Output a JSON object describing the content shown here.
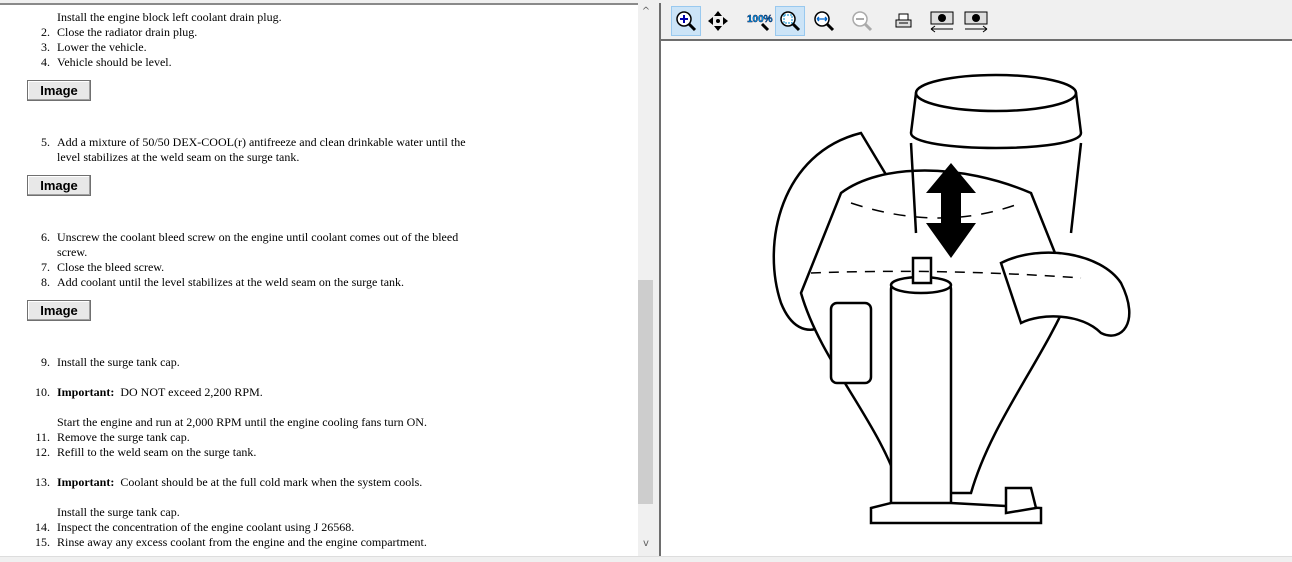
{
  "steps": [
    {
      "num": "",
      "text": "Install the engine block left coolant drain plug."
    },
    {
      "num": "2.",
      "text": "Close the radiator drain plug."
    },
    {
      "num": "3.",
      "text": "Lower the vehicle."
    },
    {
      "num": "4.",
      "text": "Vehicle should be level."
    },
    {
      "num": "5.",
      "text": "Add a mixture of 50/50 DEX-COOL(r) antifreeze and clean drinkable water until the"
    },
    {
      "num": "",
      "text": "level stabilizes at the weld seam on the surge tank."
    },
    {
      "num": "6.",
      "text": "Unscrew the coolant bleed screw on the engine until coolant comes out of the bleed"
    },
    {
      "num": "",
      "text": "screw."
    },
    {
      "num": "7.",
      "text": "Close the bleed screw."
    },
    {
      "num": "8.",
      "text": "Add coolant until the level stabilizes at the weld seam on the surge tank."
    },
    {
      "num": "9.",
      "text": "Install the surge tank cap."
    },
    {
      "num": "10.",
      "label": "Important:",
      "text": "DO NOT exceed 2,200 RPM."
    },
    {
      "num": "",
      "text": "Start the engine and run at 2,000 RPM until the engine cooling fans turn ON."
    },
    {
      "num": "11.",
      "text": "Remove the surge tank cap."
    },
    {
      "num": "12.",
      "text": "Refill to the weld seam on the surge tank."
    },
    {
      "num": "13.",
      "label": "Important:",
      "text": "Coolant should be at the full cold mark when the system cools."
    },
    {
      "num": "",
      "text": "Install the surge tank cap."
    },
    {
      "num": "14.",
      "text": "Inspect the concentration of the engine coolant using J 26568."
    },
    {
      "num": "15.",
      "text": "Rinse away any excess coolant from the engine and the engine compartment."
    }
  ],
  "image_buttons": [
    "Image",
    "Image",
    "Image"
  ],
  "toolbar": [
    "zoom-in-icon",
    "pan-icon",
    "zoom-100-icon",
    "zoom-fit-icon",
    "zoom-width-icon",
    "zoom-out-icon",
    "print-icon",
    "previous-image-icon",
    "next-image-icon"
  ],
  "scrollbar": {
    "position_fraction": 0.5
  }
}
